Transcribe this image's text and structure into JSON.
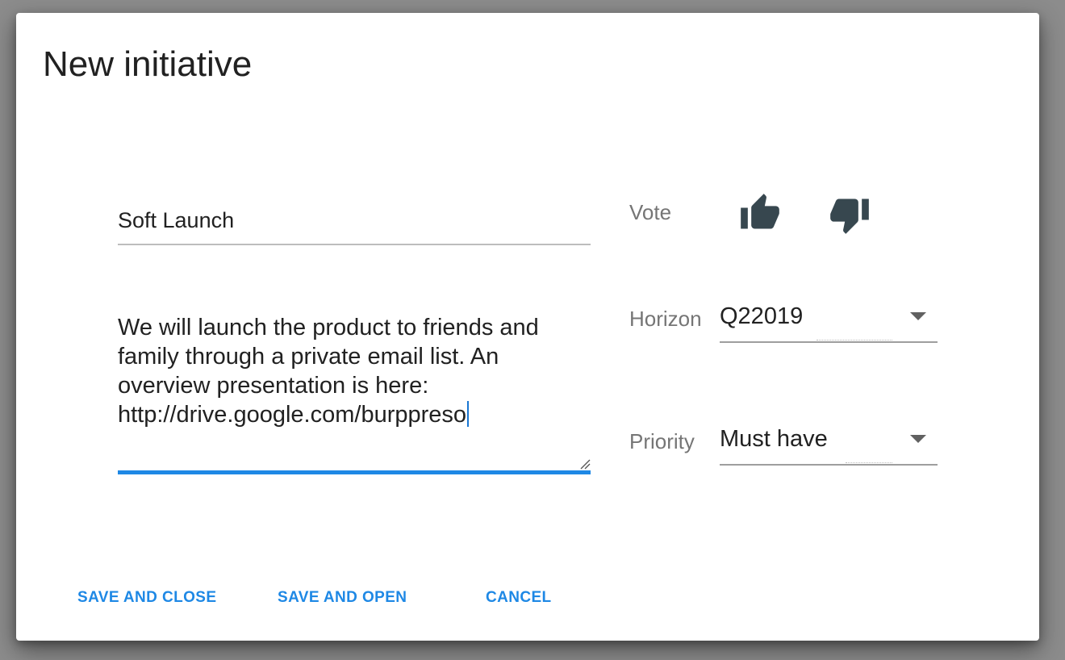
{
  "dialog": {
    "title": "New initiative"
  },
  "form": {
    "name_value": "Soft Launch",
    "description_lines": [
      "We will launch the product to friends and",
      "family through a private email list. An",
      "overview presentation is here:",
      "http://drive.google.com/burppreso"
    ],
    "vote_label": "Vote",
    "vote_up_icon": "thumb-up-icon",
    "vote_down_icon": "thumb-down-icon",
    "horizon_label": "Horizon",
    "horizon_value": "Q22019",
    "priority_label": "Priority",
    "priority_value": "Must have"
  },
  "actions": {
    "save_and_close": "SAVE AND CLOSE",
    "save_and_open": "SAVE AND OPEN",
    "cancel": "CANCEL"
  },
  "colors": {
    "accent": "#1e88e5",
    "icon": "#37474f",
    "backdrop": "#8c8c8c"
  }
}
